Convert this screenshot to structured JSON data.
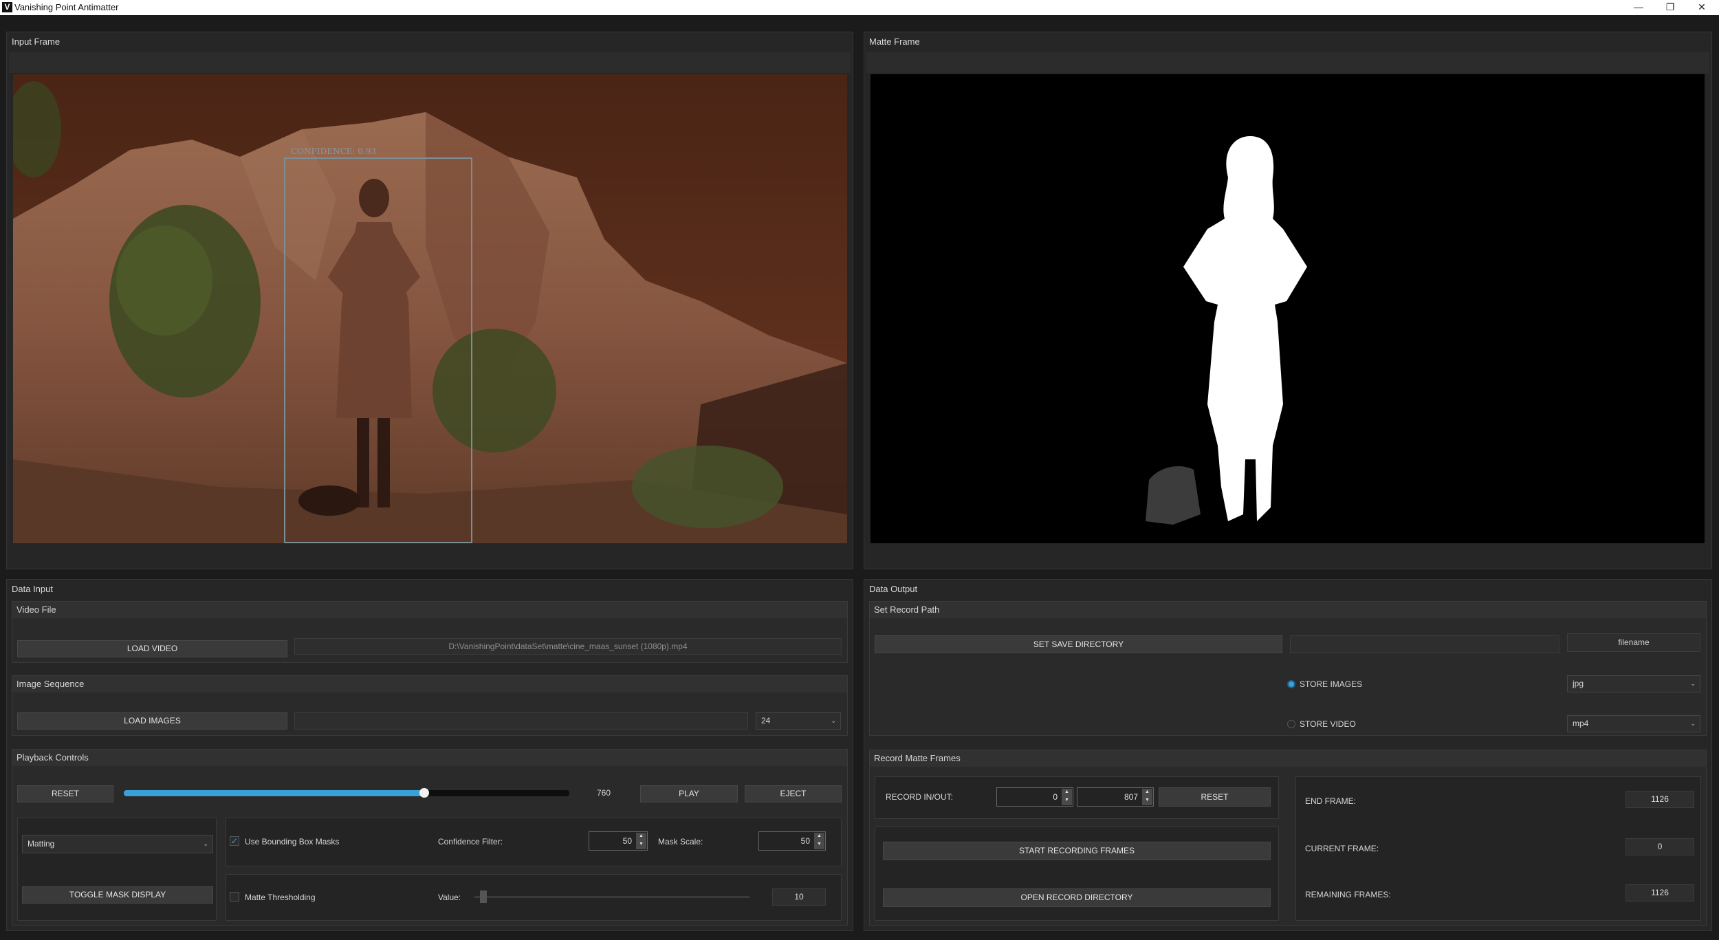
{
  "window": {
    "title": "Vanishing Point Antimatter",
    "logo_letter": "V",
    "minimize": "—",
    "restore": "❐",
    "close": "✕"
  },
  "input_frame": {
    "title": "Input Frame",
    "detection_label": "CONFIDENCE: 0.93"
  },
  "matte_frame": {
    "title": "Matte Frame"
  },
  "data_input": {
    "title": "Data Input",
    "video_file": {
      "header": "Video File",
      "load_label": "LOAD VIDEO",
      "path": "D:\\VanishingPoint\\dataSet\\matte\\cine_maas_sunset (1080p).mp4"
    },
    "image_sequence": {
      "header": "Image Sequence",
      "load_label": "LOAD IMAGES",
      "path": "",
      "fps": "24"
    },
    "playback": {
      "header": "Playback Controls",
      "reset_label": "RESET",
      "frame": "760",
      "progress": 0.675,
      "play_label": "PLAY",
      "eject_label": "EJECT"
    },
    "mode": {
      "selected": "Matting",
      "toggle_label": "TOGGLE MASK DISPLAY"
    },
    "mask_options": {
      "bbox_label": "Use Bounding Box Masks",
      "bbox_checked": true,
      "confidence_label": "Confidence Filter:",
      "confidence_value": "50",
      "scale_label": "Mask Scale:",
      "scale_value": "50"
    },
    "thresholding": {
      "label": "Matte Thresholding",
      "checked": false,
      "value_label": "Value:",
      "value": "10",
      "slider_fraction": 0.02
    }
  },
  "data_output": {
    "title": "Data Output",
    "record_path": {
      "header": "Set Record Path",
      "save_dir_label": "SET SAVE DIRECTORY",
      "directory": "",
      "filename": "filename",
      "store_images_label": "STORE IMAGES",
      "store_video_label": "STORE VIDEO",
      "image_format": "jpg",
      "video_format": "mp4"
    },
    "record_matte": {
      "header": "Record Matte Frames",
      "inout_label": "RECORD IN/OUT:",
      "in_value": "0",
      "out_value": "807",
      "reset_label": "RESET",
      "start_label": "START RECORDING FRAMES",
      "open_label": "OPEN RECORD DIRECTORY",
      "end_frame_label": "END FRAME:",
      "end_frame": "1126",
      "current_frame_label": "CURRENT FRAME:",
      "current_frame": "0",
      "remaining_label": "REMAINING FRAMES:",
      "remaining": "1126"
    }
  },
  "colors": {
    "accent": "#3aa0d8",
    "background": "#1b1b1b",
    "panel": "#262626"
  }
}
